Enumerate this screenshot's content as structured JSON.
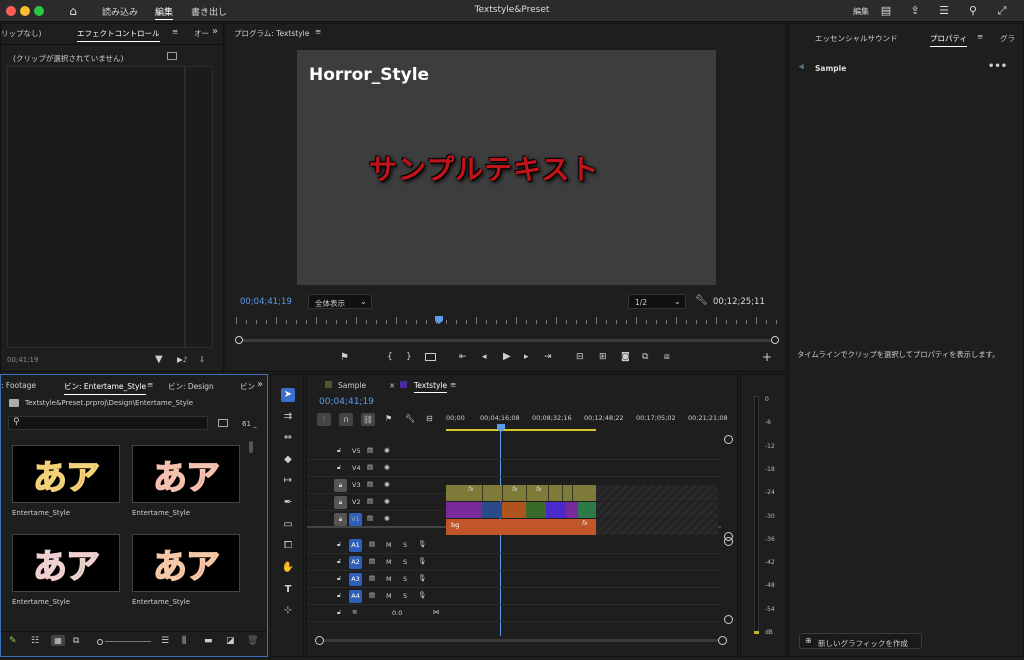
{
  "titlebar": {
    "menu": [
      "読み込み",
      "編集",
      "書き出し"
    ],
    "active_menu": "編集",
    "title": "Textstyle&Preset",
    "right_label": "編集"
  },
  "effects_panel": {
    "tab_left": "リップなし)",
    "tab_active": "エフェクトコントロール",
    "tab_right": "オー",
    "message": "(クリップが選択されていません)",
    "timecode": "00;41;19"
  },
  "program_monitor": {
    "title": "プログラム: Textstyle",
    "preview_title": "Horror_Style",
    "preview_text": "サンプルテキスト",
    "timecode_current": "00;04;41;19",
    "fit_label": "全体表示",
    "resolution": "1/2",
    "timecode_duration": "00;12;25;11"
  },
  "properties_panel": {
    "tab_sound": "エッセンシャルサウンド",
    "tab_active": "プロパティ",
    "tab_more": "グラ",
    "item_name": "Sample",
    "hint": "タイムラインでクリップを選択してプロパティを表示します。",
    "new_graphic_button": "新しいグラフィックを作成"
  },
  "project_panel": {
    "tab_footage": ": Footage",
    "tab_active": "ビン: Entertame_Style",
    "tab_design": "ビン: Design",
    "tab_more": "ビン",
    "path": "Textstyle&Preset.prproj\\Design\\Entertame_Style",
    "count": "61 _",
    "items": [
      {
        "label": "Entertame_Style",
        "glyph": "あア",
        "fill": "#e23a3a",
        "stroke": "#f2d37a"
      },
      {
        "label": "Entertame_Style",
        "glyph": "あア",
        "fill": "#e05050",
        "stroke": "#f5c2b0"
      },
      {
        "label": "Entertame_Style",
        "glyph": "あア",
        "fill": "#2ec04a",
        "stroke": "#f0d0d0"
      },
      {
        "label": "Entertame_Style",
        "glyph": "あア",
        "fill": "#e24a3a",
        "stroke": "#f5c8a8"
      }
    ]
  },
  "timeline": {
    "tab_sample": "Sample",
    "tab_active": "Textstyle",
    "timecode": "00;04;41;19",
    "ruler": [
      "00;00",
      "00;04;16;08",
      "00;08;32;16",
      "00;12;48;22",
      "00;17;05;02",
      "00;21;21;08"
    ],
    "video_tracks": [
      "V5",
      "V4",
      "V3",
      "V2",
      "V1"
    ],
    "audio_tracks": [
      "A1",
      "A2",
      "A3",
      "A4"
    ],
    "mix_value": "0.0",
    "clip_label_bg": "bg",
    "fx_label": "fx",
    "mute": "M",
    "solo": "S"
  },
  "meter": {
    "labels": [
      "0",
      "-6",
      "-12",
      "-18",
      "-24",
      "-30",
      "-36",
      "-42",
      "-48",
      "-54",
      "dB"
    ]
  },
  "colors": {
    "accent": "#5b9bf0",
    "track_active": "#2f5fb8",
    "preview_text": "#c0141a",
    "clip_v1": "#c0562a",
    "clip_v3": "#7d7a3a"
  }
}
